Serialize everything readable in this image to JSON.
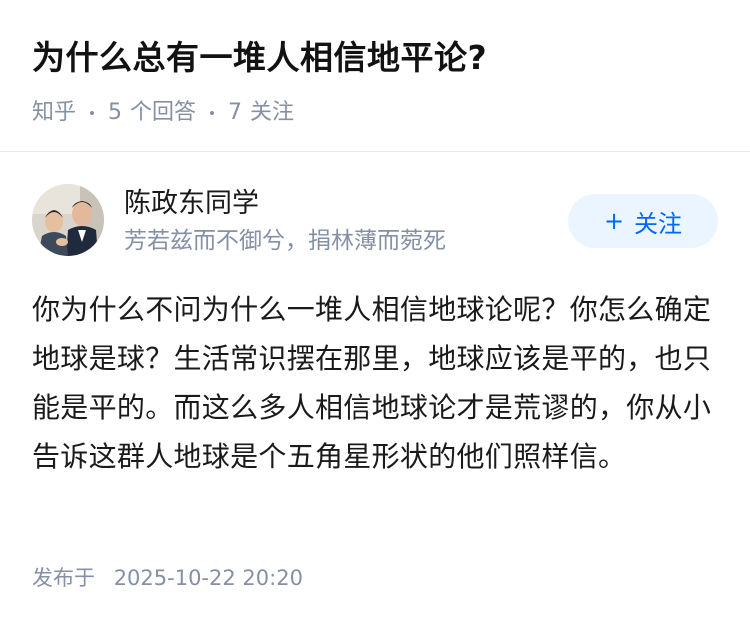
{
  "question": {
    "title": "为什么总有一堆人相信地平论?",
    "source": "知乎",
    "answer_count": "5",
    "answer_label": "个回答",
    "follow_count": "7",
    "follow_label": "关注"
  },
  "author": {
    "name": "陈政东同学",
    "bio": "芳若兹而不御兮，捐林薄而菀死",
    "follow_button_icon": "+",
    "follow_button_label": "关注",
    "accent_color": "#0066ff",
    "button_bg_color": "#ebf5ff"
  },
  "answer": {
    "content": "你为什么不问为什么一堆人相信地球论呢？你怎么确定地球是球？生活常识摆在那里，地球应该是平的，也只能是平的。而这么多人相信地球论才是荒谬的，你从小告诉这群人地球是个五角星形状的他们照样信。",
    "publish_label": "发布于",
    "publish_time": "2025-10-22 20:20"
  },
  "colors": {
    "meta_text": "#8590a6",
    "body_text": "#1a1a1a"
  }
}
